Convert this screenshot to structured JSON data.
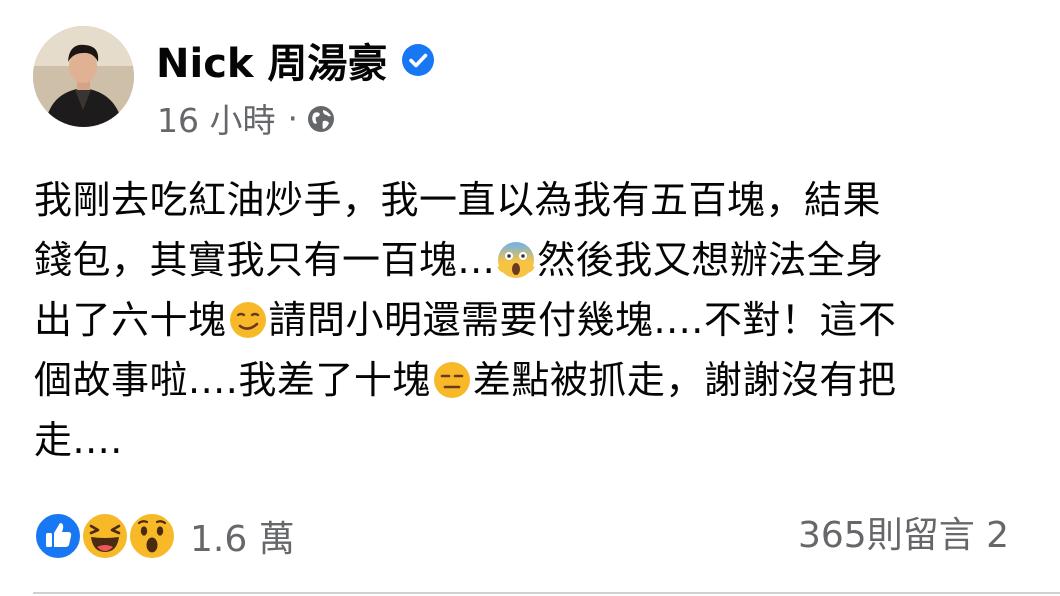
{
  "author": {
    "name": "Nick 周湯豪",
    "avatar_icon": "profile-photo",
    "verified_icon": "verified-badge-icon",
    "verified_color": "#1877f2"
  },
  "meta": {
    "time": "16 小時",
    "separator": "·",
    "privacy_icon": "globe-icon"
  },
  "post": {
    "line1": {
      "text": "我剛去吃紅油炒手，我一直以為我有五百塊，結果"
    },
    "line2": {
      "a": "錢包，其實我只有一百塊...",
      "emoji": "face-screaming-in-fear",
      "b": "然後我又想辦法全身"
    },
    "line3": {
      "a": "出了六十塊",
      "emoji": "smirking-face",
      "b": "請問小明還需要付幾塊....不對！這不"
    },
    "line4": {
      "a": "個故事啦....我差了十塊",
      "emoji": "expressionless-face",
      "b": "差點被抓走，謝謝沒有把"
    },
    "line5": {
      "text": "走...."
    }
  },
  "reactions": {
    "icons": [
      "like-icon",
      "haha-icon",
      "wow-icon"
    ],
    "count": "1.6 萬",
    "like_color": "#1877f2",
    "emoji_color": "#f7b928"
  },
  "comments": {
    "label": "365則留言 2"
  }
}
